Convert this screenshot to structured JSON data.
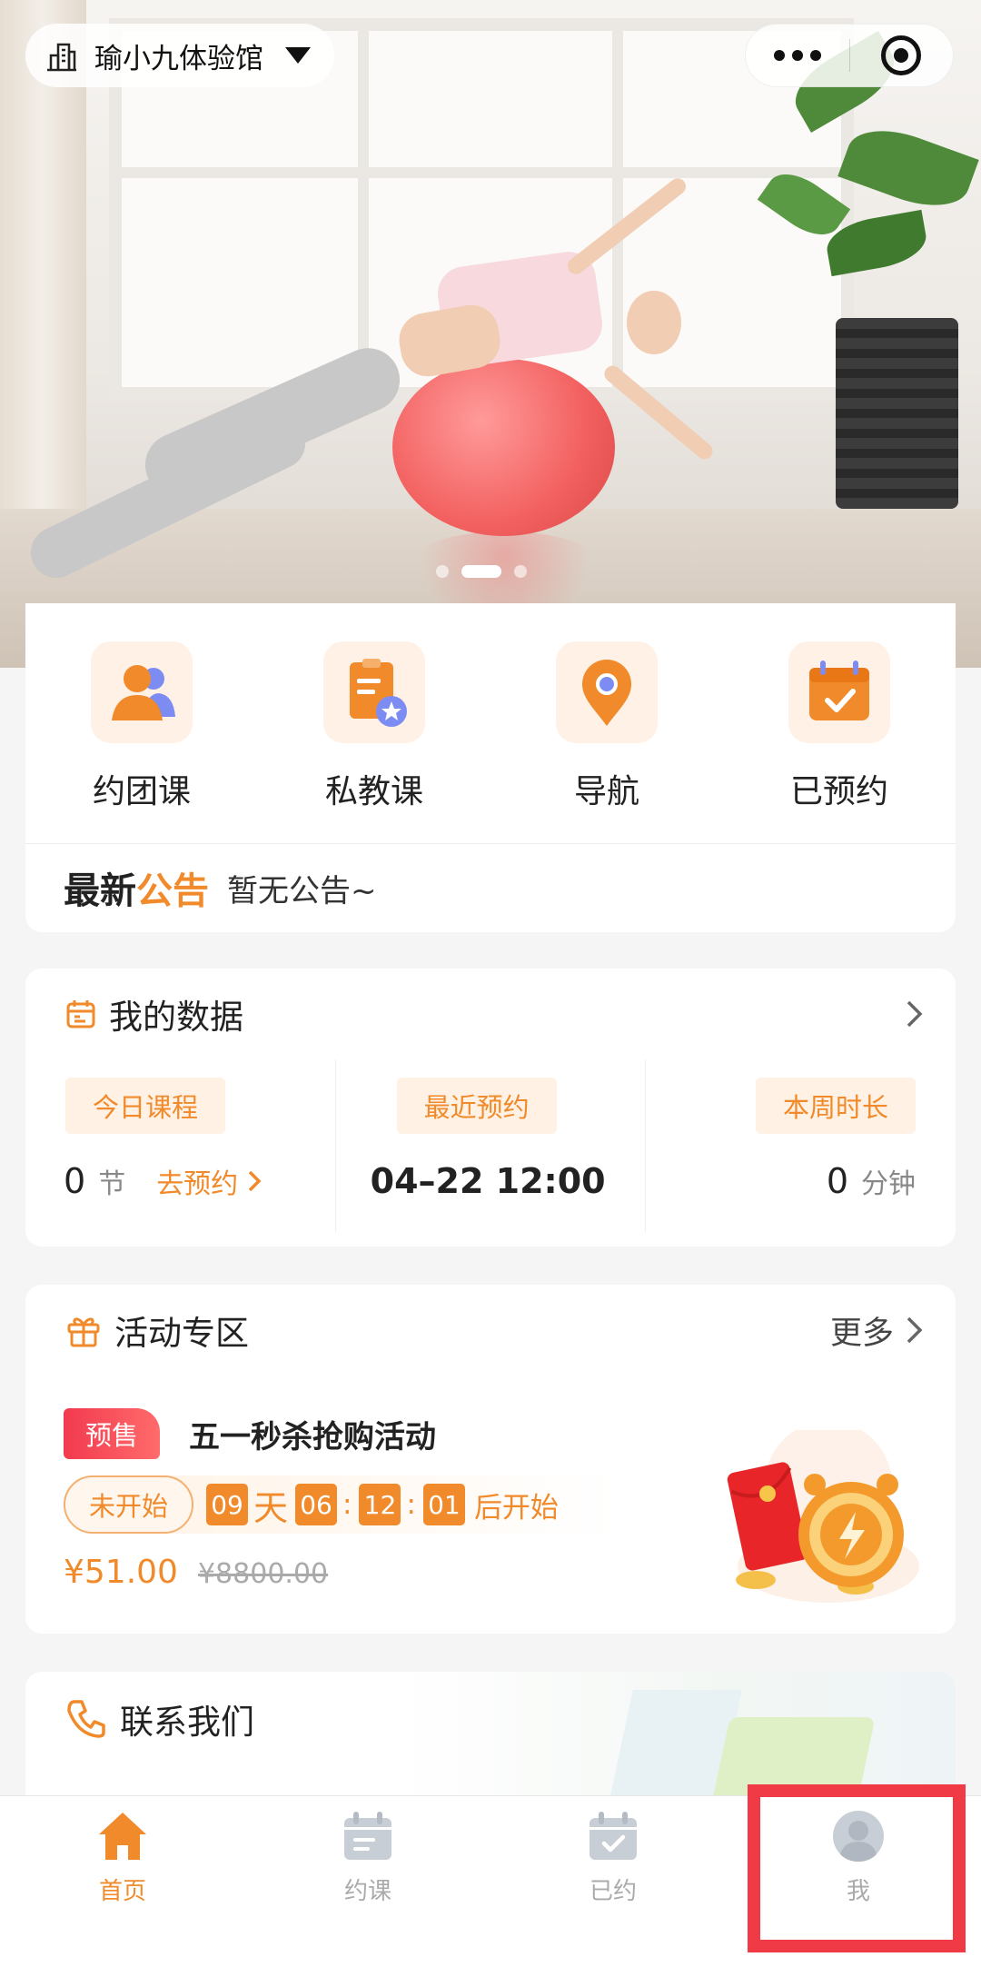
{
  "header": {
    "store_name": "瑜小九体验馆"
  },
  "banner": {
    "slide_count": 3,
    "active_slide": 2
  },
  "quick_actions": [
    {
      "label": "约团课",
      "icon": "group-users-icon"
    },
    {
      "label": "私教课",
      "icon": "clipboard-star-icon"
    },
    {
      "label": "导航",
      "icon": "location-pin-icon"
    },
    {
      "label": "已预约",
      "icon": "calendar-check-icon"
    }
  ],
  "notice": {
    "title_part1": "最新",
    "title_part2": "公告",
    "text": "暂无公告~"
  },
  "my_data": {
    "title": "我的数据",
    "today": {
      "tag": "今日课程",
      "value": "0",
      "unit": "节",
      "link": "去预约"
    },
    "recent": {
      "tag": "最近预约",
      "value": "04–22 12:00"
    },
    "week": {
      "tag": "本周时长",
      "value": "0",
      "unit": "分钟"
    }
  },
  "activity": {
    "title": "活动专区",
    "more": "更多",
    "badge": "预售",
    "name": "五一秒杀抢购活动",
    "status": "未开始",
    "countdown": {
      "days": "09",
      "days_label": "天",
      "hours": "06",
      "minutes": "12",
      "seconds": "01",
      "suffix": "后开始"
    },
    "price": "¥51.00",
    "original_price": "¥8800.00"
  },
  "contact": {
    "title": "联系我们"
  },
  "tabbar": [
    {
      "label": "首页",
      "icon": "home-icon",
      "active": true
    },
    {
      "label": "约课",
      "icon": "calendar-icon",
      "active": false
    },
    {
      "label": "已约",
      "icon": "calendar-check-icon",
      "active": false
    },
    {
      "label": "我",
      "icon": "user-icon",
      "active": false
    }
  ],
  "colors": {
    "accent": "#f08a2a",
    "presale_badge": "#f23a4f",
    "highlight_box": "#f03a46",
    "tab_inactive": "#aaaaaa"
  }
}
